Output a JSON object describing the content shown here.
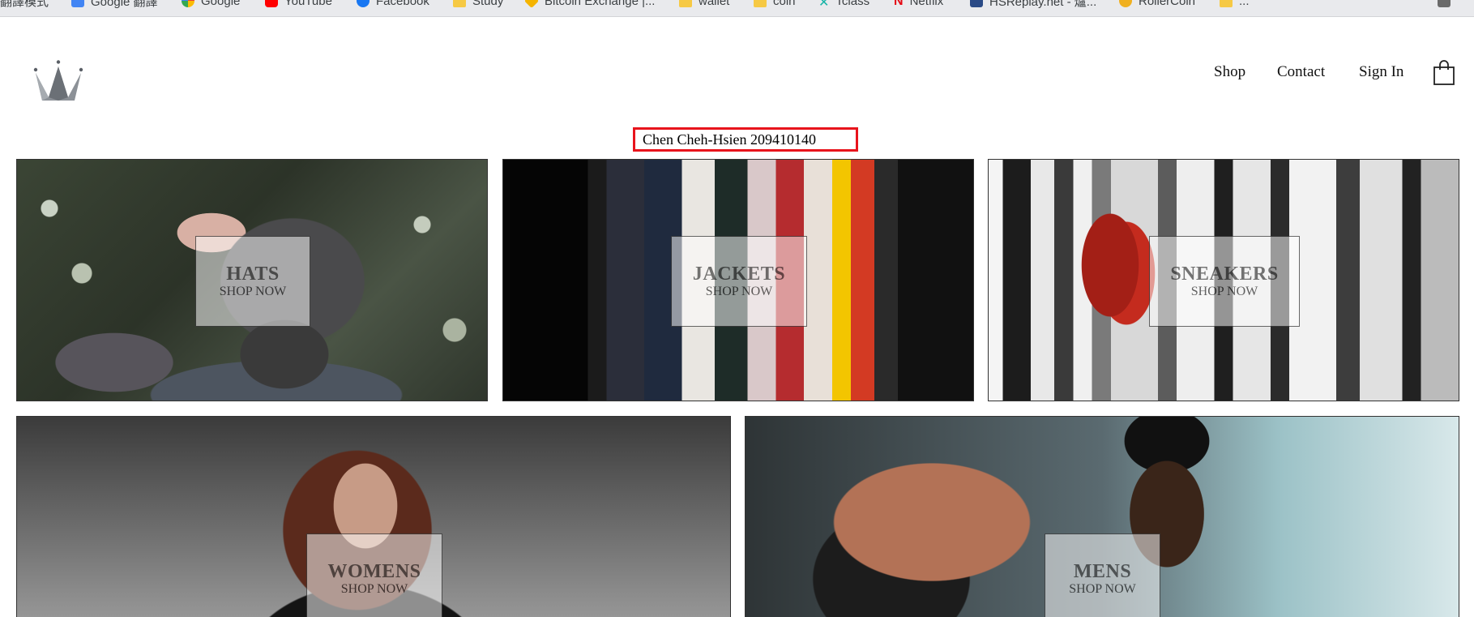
{
  "bookmarks": [
    {
      "label": "翻譯模式",
      "icon": "folder-icon"
    },
    {
      "label": "Google 翻譯",
      "icon": "google-translate-icon"
    },
    {
      "label": "Google",
      "icon": "google-icon"
    },
    {
      "label": "YouTube",
      "icon": "youtube-icon"
    },
    {
      "label": "Facebook",
      "icon": "facebook-icon"
    },
    {
      "label": "Study",
      "icon": "folder-icon"
    },
    {
      "label": "Bitcoin Exchange |...",
      "icon": "diamond-icon"
    },
    {
      "label": "wallet",
      "icon": "folder-icon"
    },
    {
      "label": "coin",
      "icon": "folder-icon"
    },
    {
      "label": "Tclass",
      "icon": "tclass-icon"
    },
    {
      "label": "Netflix",
      "icon": "netflix-icon"
    },
    {
      "label": "HSReplay.net - 爐...",
      "icon": "hsreplay-icon"
    },
    {
      "label": "RollerCoin",
      "icon": "rollercoin-icon"
    },
    {
      "label": "...",
      "icon": "folder-icon"
    }
  ],
  "header": {
    "logo": "crown-logo",
    "nav": {
      "shop": "Shop",
      "contact": "Contact",
      "sign_in": "Sign In"
    },
    "cart_icon": "shopping-bag-icon"
  },
  "student_label": "Chen Cheh-Hsien 209410140",
  "categories": [
    {
      "title": "HATS",
      "subtitle": "SHOP NOW"
    },
    {
      "title": "JACKETS",
      "subtitle": "SHOP NOW"
    },
    {
      "title": "SNEAKERS",
      "subtitle": "SHOP NOW"
    },
    {
      "title": "WOMENS",
      "subtitle": "SHOP NOW"
    },
    {
      "title": "MENS",
      "subtitle": "SHOP NOW"
    }
  ],
  "colors": {
    "highlight_border": "#e8141c",
    "text": "#111111",
    "logo": "#5a5f66"
  }
}
